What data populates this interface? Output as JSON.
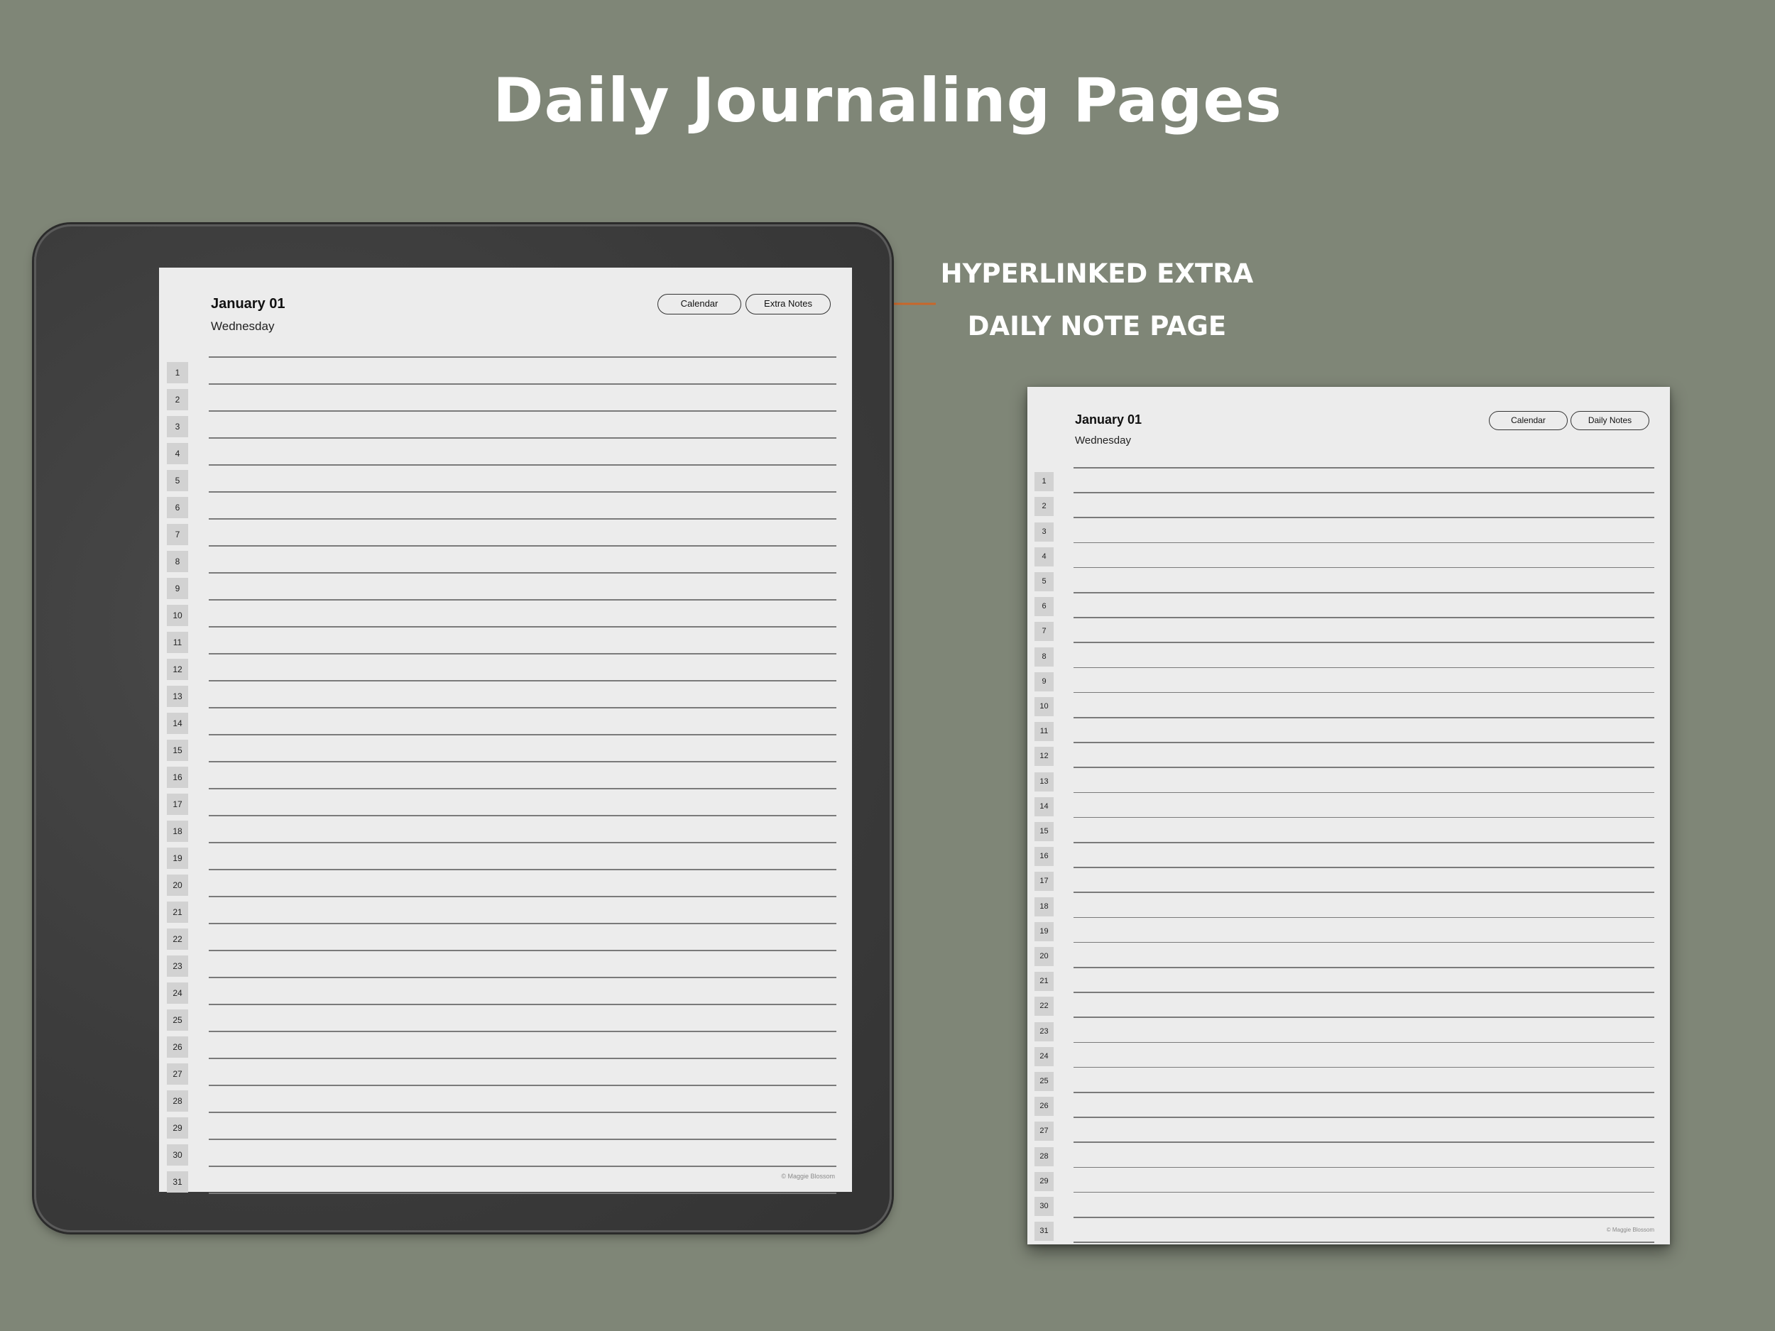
{
  "heading": "Daily Journaling Pages",
  "annotation": {
    "line1": "HYPERLINKED EXTRA",
    "line2": "DAILY NOTE PAGE",
    "arrow_color": "#c8672a"
  },
  "main_page": {
    "title": "January 01",
    "day": "Wednesday",
    "buttons": [
      "Calendar",
      "Extra Notes"
    ],
    "footer": "© Maggie Blossom",
    "line_numbers": [
      "1",
      "2",
      "3",
      "4",
      "5",
      "6",
      "7",
      "8",
      "9",
      "10",
      "11",
      "12",
      "13",
      "14",
      "15",
      "16",
      "17",
      "18",
      "19",
      "20",
      "21",
      "22",
      "23",
      "24",
      "25",
      "26",
      "27",
      "28",
      "29",
      "30",
      "31"
    ]
  },
  "notes_page": {
    "title": "January 01",
    "day": "Wednesday",
    "buttons": [
      "Calendar",
      "Daily Notes"
    ],
    "footer": "© Maggie Blossom",
    "line_numbers": [
      "1",
      "2",
      "3",
      "4",
      "5",
      "6",
      "7",
      "8",
      "9",
      "10",
      "11",
      "12",
      "13",
      "14",
      "15",
      "16",
      "17",
      "18",
      "19",
      "20",
      "21",
      "22",
      "23",
      "24",
      "25",
      "26",
      "27",
      "28",
      "29",
      "30",
      "31"
    ]
  },
  "colors": {
    "background": "#7f8677",
    "device_frame": "#3c3c3c",
    "paper": "#ececec",
    "number_box": "#d2d2d2"
  }
}
